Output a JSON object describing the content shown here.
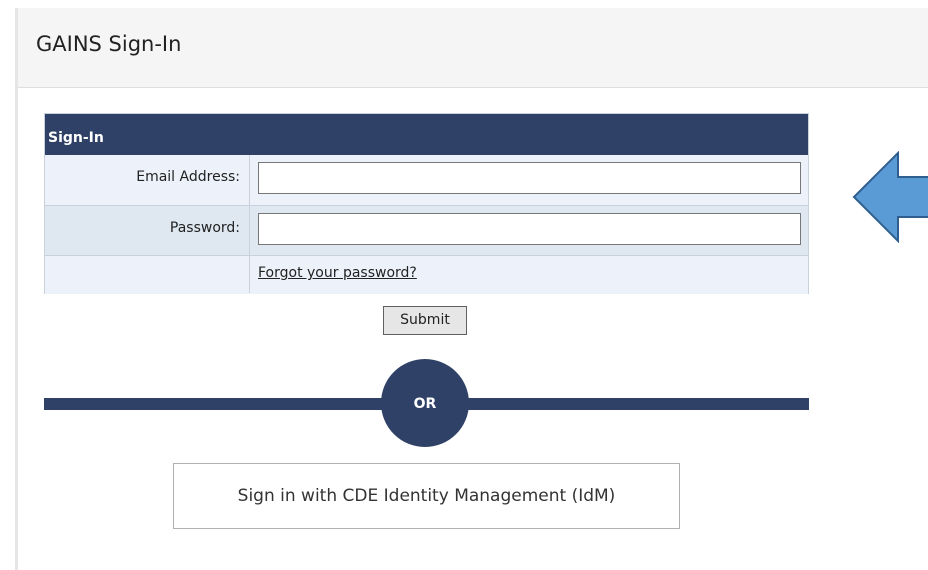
{
  "header": {
    "title": "GAINS Sign-In"
  },
  "form": {
    "section_title": "Sign-In",
    "email_label": "Email Address:",
    "email_value": "",
    "password_label": "Password:",
    "password_value": "",
    "forgot_link": "Forgot your password?",
    "submit_label": "Submit"
  },
  "divider": {
    "or_text": "OR"
  },
  "idm": {
    "button_label": "Sign in with CDE Identity Management (IdM)"
  },
  "colors": {
    "navy": "#2f4166",
    "arrow_fill": "#5b9bd5",
    "arrow_stroke": "#2e5f8f"
  }
}
